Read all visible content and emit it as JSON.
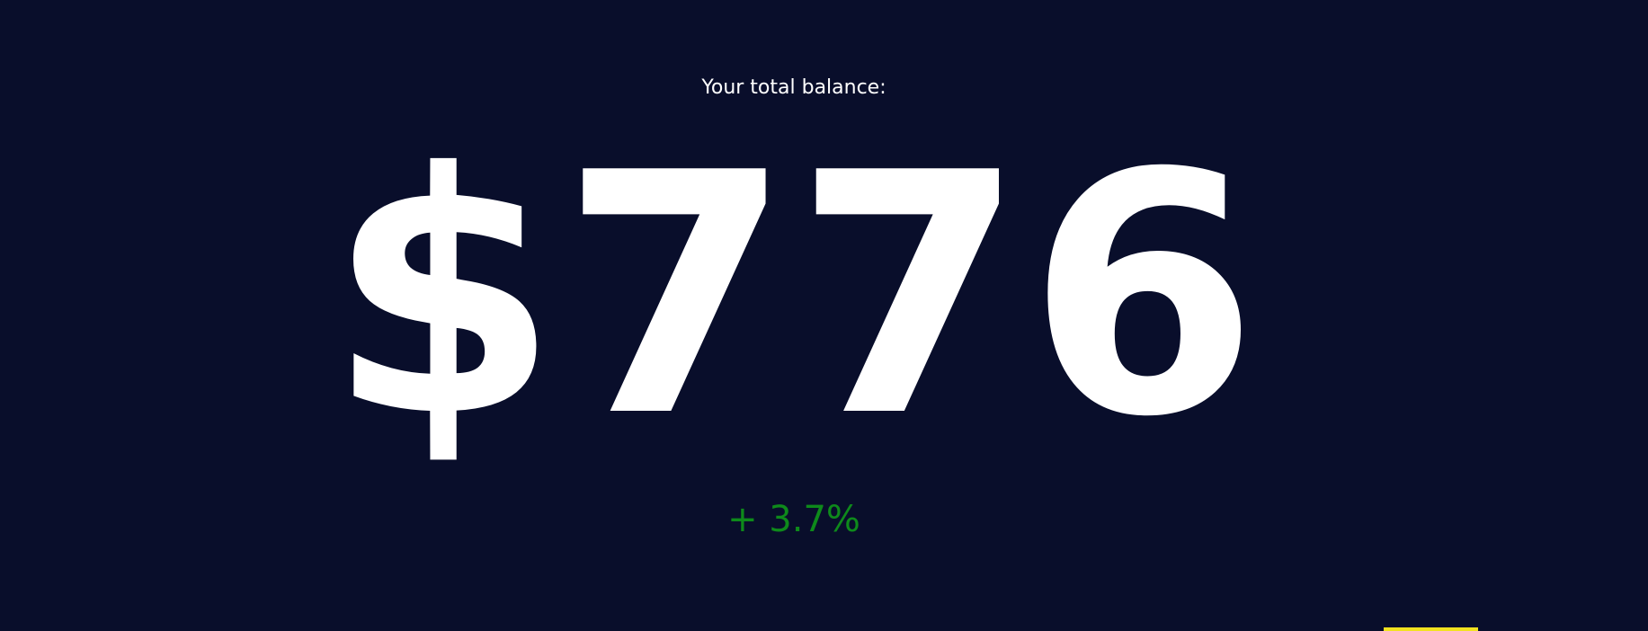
{
  "balance": {
    "label": "Your total balance:",
    "amount": "$776",
    "change": "+ 3.7%"
  },
  "colors": {
    "background": "#090e2b",
    "text": "#ffffff",
    "positive_change": "#0e8a1b",
    "accent": "#f2e21f"
  }
}
